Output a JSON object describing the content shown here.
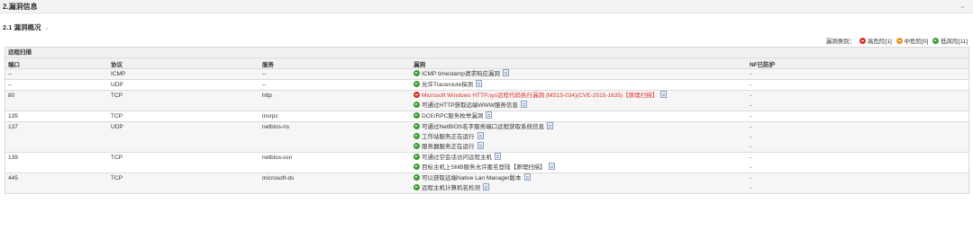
{
  "section": {
    "title": "2.漏洞信息"
  },
  "subsection": {
    "title": "2.1 漏洞概况"
  },
  "legend": {
    "label": "漏洞类别：",
    "high": "高危险[1]",
    "mid": "中危险[0]",
    "low": "低风险[11]"
  },
  "table": {
    "caption": "远程扫描",
    "headers": {
      "port": "端口",
      "protocol": "协议",
      "service": "服务",
      "vuln": "漏洞",
      "nf": "NF已防护"
    },
    "rows": [
      {
        "port": "--",
        "protocol": "ICMP",
        "service": "--",
        "nf": "-",
        "vulns": [
          {
            "level": "low",
            "text": "ICMP timestamp请求响应漏洞"
          }
        ]
      },
      {
        "port": "--",
        "protocol": "UDP",
        "service": "--",
        "nf": "-",
        "vulns": [
          {
            "level": "low",
            "text": "允许Traceroute探测"
          }
        ]
      },
      {
        "port": "80",
        "protocol": "TCP",
        "service": "http",
        "nf": "-",
        "vulns": [
          {
            "level": "high",
            "text": "Microsoft Windows HTTP.sys远程代码执行漏洞 (MS15-034)(CVE-2015-1635)【原理扫描】"
          },
          {
            "level": "low",
            "text": "可通过HTTP获取远端WWW服务信息"
          }
        ]
      },
      {
        "port": "135",
        "protocol": "TCP",
        "service": "msrpc",
        "nf": "-",
        "vulns": [
          {
            "level": "low",
            "text": "DCE/RPC服务枚举漏洞"
          }
        ]
      },
      {
        "port": "137",
        "protocol": "UDP",
        "service": "netbios-ns",
        "nf": "-",
        "vulns": [
          {
            "level": "low",
            "text": "可通过NetBIOS名字服务端口远程获取系统信息"
          },
          {
            "level": "low",
            "text": "工作站服务正在运行"
          },
          {
            "level": "low",
            "text": "服务器服务正在运行"
          }
        ]
      },
      {
        "port": "139",
        "protocol": "TCP",
        "service": "netbios-ssn",
        "nf": "-",
        "vulns": [
          {
            "level": "low",
            "text": "可通过空会话访问远程主机"
          },
          {
            "level": "low",
            "text": "目标主机上SMB服务允许匿名登陆【原理扫描】"
          }
        ]
      },
      {
        "port": "445",
        "protocol": "TCP",
        "service": "microsoft-ds",
        "nf": "-",
        "vulns": [
          {
            "level": "low",
            "text": "可以获取远端Native Lan Manager版本"
          },
          {
            "level": "low",
            "text": "远程主机计算机名检测"
          }
        ]
      }
    ]
  }
}
